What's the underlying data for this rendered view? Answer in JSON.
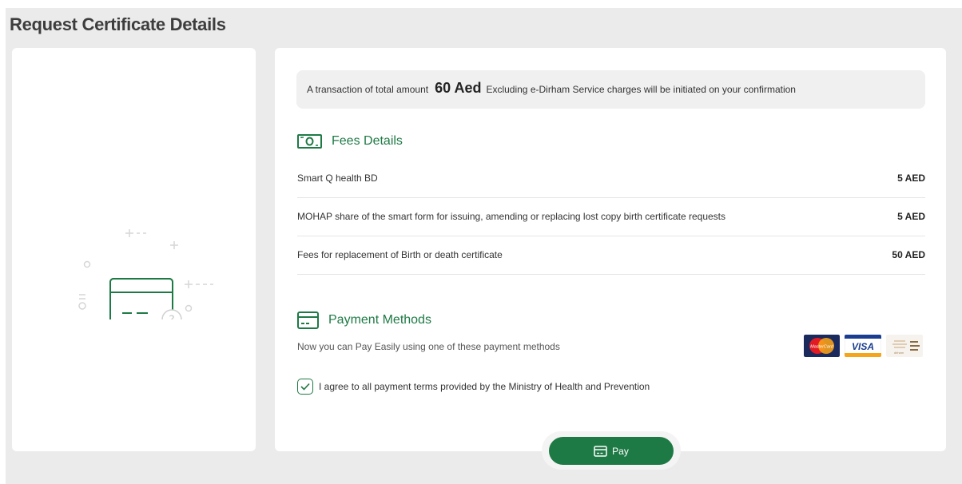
{
  "page": {
    "title": "Request Certificate Details"
  },
  "notice": {
    "prefix": "A transaction of total amount",
    "amount": "60 Aed",
    "suffix": "Excluding e-Dirham Service charges will be initiated on your confirmation"
  },
  "fees": {
    "title": "Fees Details",
    "icon": "money-icon",
    "items": [
      {
        "label": "Smart Q health BD",
        "amount": "5 AED"
      },
      {
        "label": "MOHAP share of the smart form for issuing, amending or replacing lost copy birth certificate requests",
        "amount": "5 AED"
      },
      {
        "label": "Fees for replacement of Birth or death certificate",
        "amount": "50 AED"
      }
    ]
  },
  "payment": {
    "title": "Payment Methods",
    "icon": "card-icon",
    "description": "Now you can Pay Easily using one of these payment methods",
    "methods": [
      "mastercard-logo",
      "visa-logo",
      "edirham-logo"
    ],
    "logo_text": {
      "mastercard": "MasterCard",
      "visa": "VISA",
      "edirham": "dirham"
    }
  },
  "agreement": {
    "checked": true,
    "label": "I agree to all payment terms provided by the Ministry of Health and Prevention"
  },
  "actions": {
    "pay_label": "Pay"
  },
  "colors": {
    "accent": "#1e7a45",
    "page_bg": "#ebebeb",
    "card_bg": "#ffffff"
  }
}
